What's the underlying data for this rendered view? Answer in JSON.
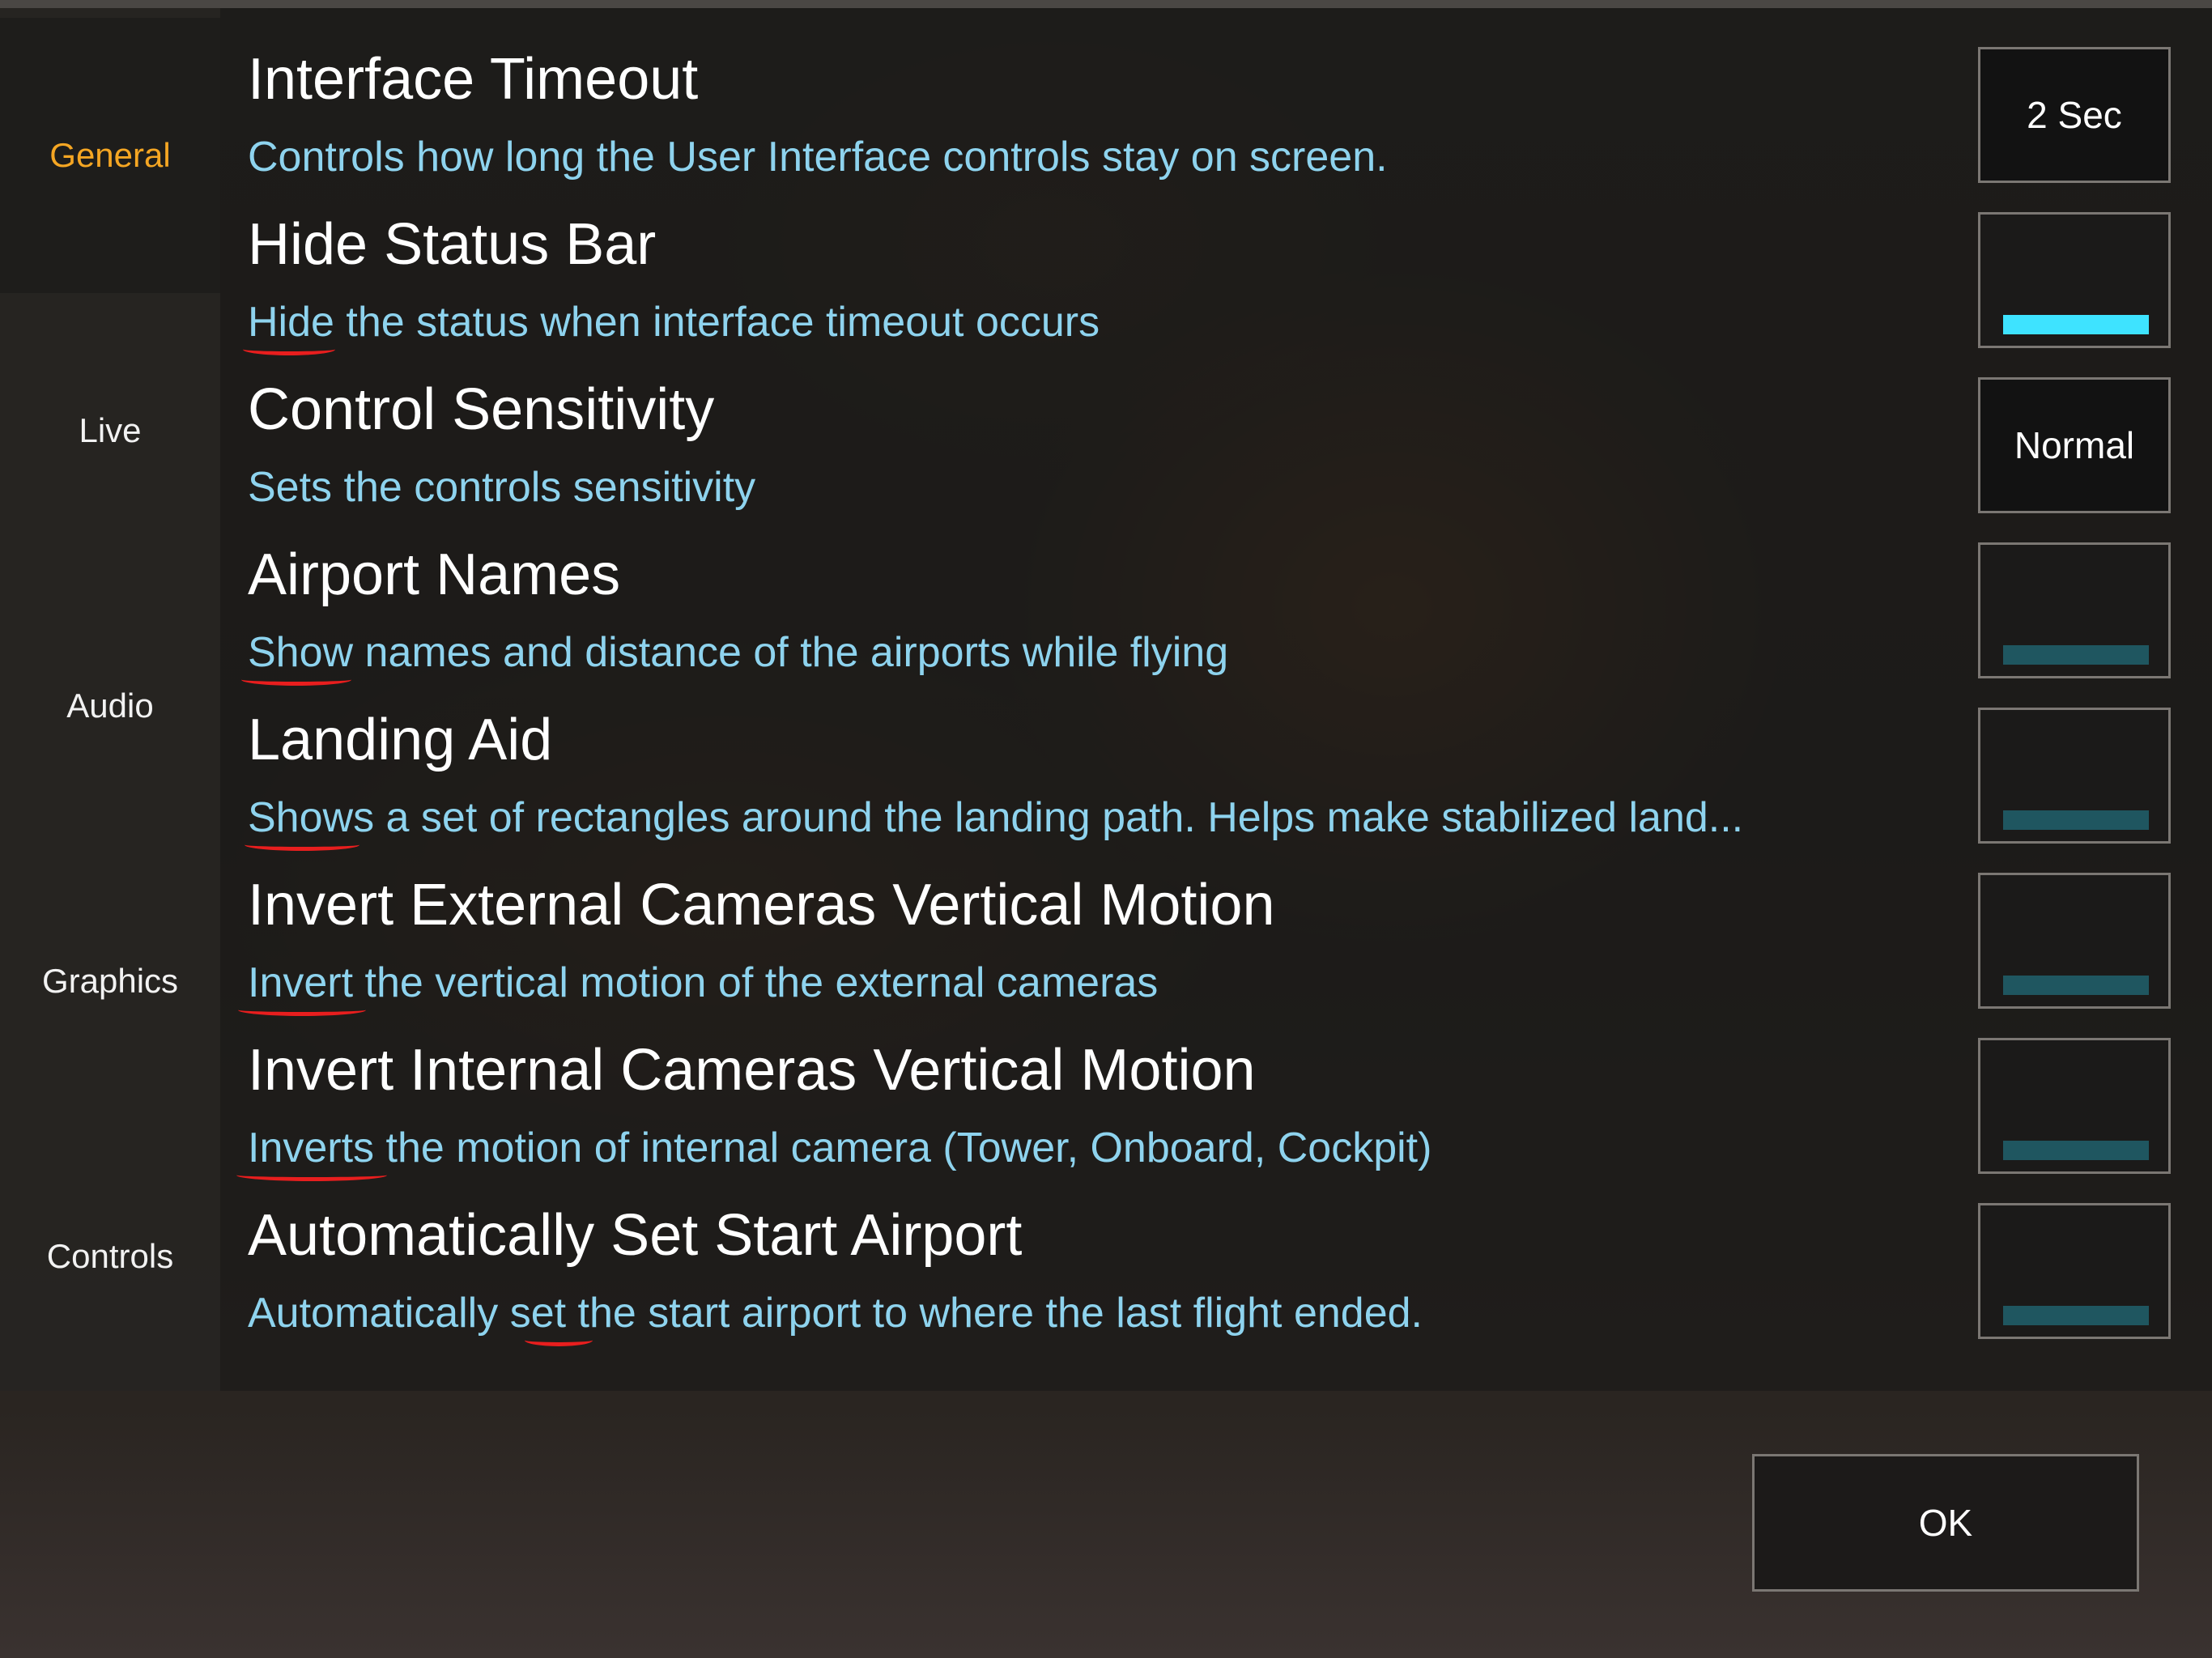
{
  "colors": {
    "active_tab": "#f5a623",
    "description_text": "#8ed3ee",
    "toggle_on": "#3ee3ff",
    "toggle_off": "#1f5660",
    "spellcheck_underline": "#e81e1e"
  },
  "sidebar": {
    "items": [
      {
        "label": "General",
        "active": true
      },
      {
        "label": "Live",
        "active": false
      },
      {
        "label": "Audio",
        "active": false
      },
      {
        "label": "Graphics",
        "active": false
      },
      {
        "label": "Controls",
        "active": false
      }
    ]
  },
  "settings": [
    {
      "title": "Interface Timeout",
      "description": "Controls how long the User Interface controls stay on screen.",
      "control": {
        "type": "value",
        "value": "2 Sec"
      }
    },
    {
      "title": "Hide Status Bar",
      "description_first": "Hide",
      "description_rest": " the status when interface timeout occurs",
      "control": {
        "type": "toggle",
        "on": true
      }
    },
    {
      "title": "Control Sensitivity",
      "description": "Sets the controls sensitivity",
      "control": {
        "type": "value",
        "value": "Normal"
      }
    },
    {
      "title": "Airport Names",
      "description_first": "Show",
      "description_rest": " names and distance of the airports while flying",
      "control": {
        "type": "toggle",
        "on": false
      }
    },
    {
      "title": "Landing Aid",
      "description_first": "Shows",
      "description_rest": " a set of rectangles around the landing path. Helps make stabilized land...",
      "control": {
        "type": "toggle",
        "on": false
      }
    },
    {
      "title": "Invert External Cameras Vertical Motion",
      "description_first": "Invert",
      "description_rest": " the vertical motion of the external cameras",
      "control": {
        "type": "toggle",
        "on": false
      }
    },
    {
      "title": "Invert Internal Cameras Vertical Motion",
      "description_first": "Inverts",
      "description_rest": " the motion of internal camera (Tower, Onboard, Cockpit)",
      "control": {
        "type": "toggle",
        "on": false
      }
    },
    {
      "title": "Automatically Set Start Airport",
      "description_first": "Automatically ",
      "description_mid": "set",
      "description_rest": " the start airport to where the last flight ended.",
      "control": {
        "type": "toggle",
        "on": false
      }
    }
  ],
  "footer": {
    "ok_label": "OK"
  }
}
